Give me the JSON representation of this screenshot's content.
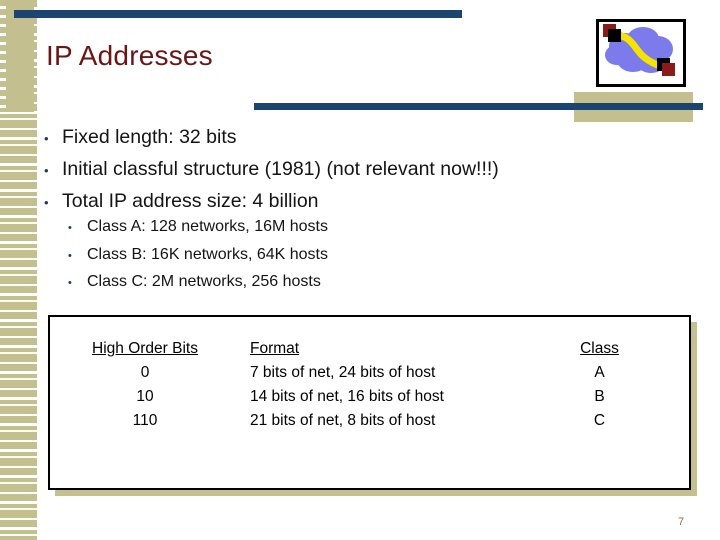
{
  "slide": {
    "title": "IP Addresses",
    "page_number": "7",
    "colors": {
      "title": "#6b1515",
      "rule_blue": "#1b4471",
      "band_tan": "#c3bf8e",
      "bullet_marker": "#1b3a5e",
      "body_text": "#141414",
      "cloud": "#7b7beb",
      "link": "#f5e400",
      "node_black": "#000000",
      "node_red": "#8b1a1a"
    }
  },
  "clipart": {
    "name": "network-cloud-diagram",
    "cloud_label": "network cloud",
    "link_label": "link",
    "node_label": "host node"
  },
  "bullets": [
    {
      "marker": "•",
      "text": "Fixed length: 32 bits"
    },
    {
      "marker": "•",
      "text": "Initial classful structure (1981) (not relevant now!!!)"
    },
    {
      "marker": "•",
      "text": "Total IP address size: 4 billion"
    }
  ],
  "sub_bullets": [
    {
      "marker": "•",
      "text": "Class A: 128 networks, 16M hosts"
    },
    {
      "marker": "•",
      "text": "Class B: 16K networks, 64K hosts"
    },
    {
      "marker": "•",
      "text": "Class C: 2M networks, 256 hosts"
    }
  ],
  "table": {
    "headers": [
      "High Order Bits",
      "Format",
      "Class"
    ],
    "rows": [
      [
        "0",
        "7 bits of net, 24 bits of host",
        "A"
      ],
      [
        "10",
        "14 bits of net, 16 bits of host",
        "B"
      ],
      [
        "110",
        "21 bits of net, 8 bits of host",
        "C"
      ]
    ]
  }
}
